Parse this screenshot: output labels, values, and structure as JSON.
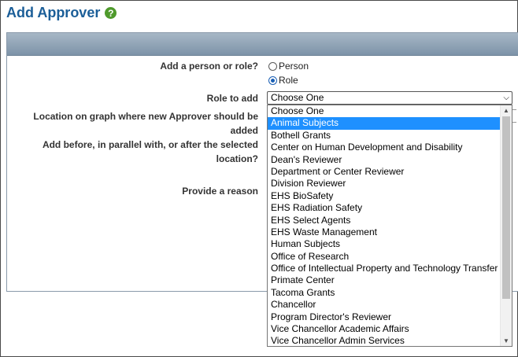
{
  "page": {
    "title": "Add Approver",
    "help_icon_glyph": "?"
  },
  "form": {
    "person_or_role_label": "Add a person or role?",
    "option_person": "Person",
    "option_role": "Role",
    "selected_option": "Role",
    "role_label": "Role to add",
    "location_label_line1": "Location on graph where new Approver should be",
    "location_label_line2": "added",
    "position_label_line1": "Add before, in parallel with, or after the selected",
    "position_label_line2": "location?",
    "reason_label": "Provide a reason"
  },
  "role_select": {
    "value": "Choose One",
    "highlighted_index": 1,
    "options": [
      "Choose One",
      "Animal Subjects",
      "Bothell Grants",
      "Center on Human Development and Disability",
      "Dean's Reviewer",
      "Department or Center Reviewer",
      "Division Reviewer",
      "EHS BioSafety",
      "EHS Radiation Safety",
      "EHS Select Agents",
      "EHS Waste Management",
      "Human Subjects",
      "Office of Research",
      "Office of Intellectual Property and Technology Transfer",
      "Primate Center",
      "Tacoma Grants",
      "Chancellor",
      "Program Director's Reviewer",
      "Vice Chancellor Academic Affairs",
      "Vice Chancellor Admin Services"
    ]
  },
  "colors": {
    "title": "#1b5e98",
    "help_icon": "#4f9a2c",
    "highlight": "#1e90ff",
    "panel_header": "#8a9fb3"
  }
}
